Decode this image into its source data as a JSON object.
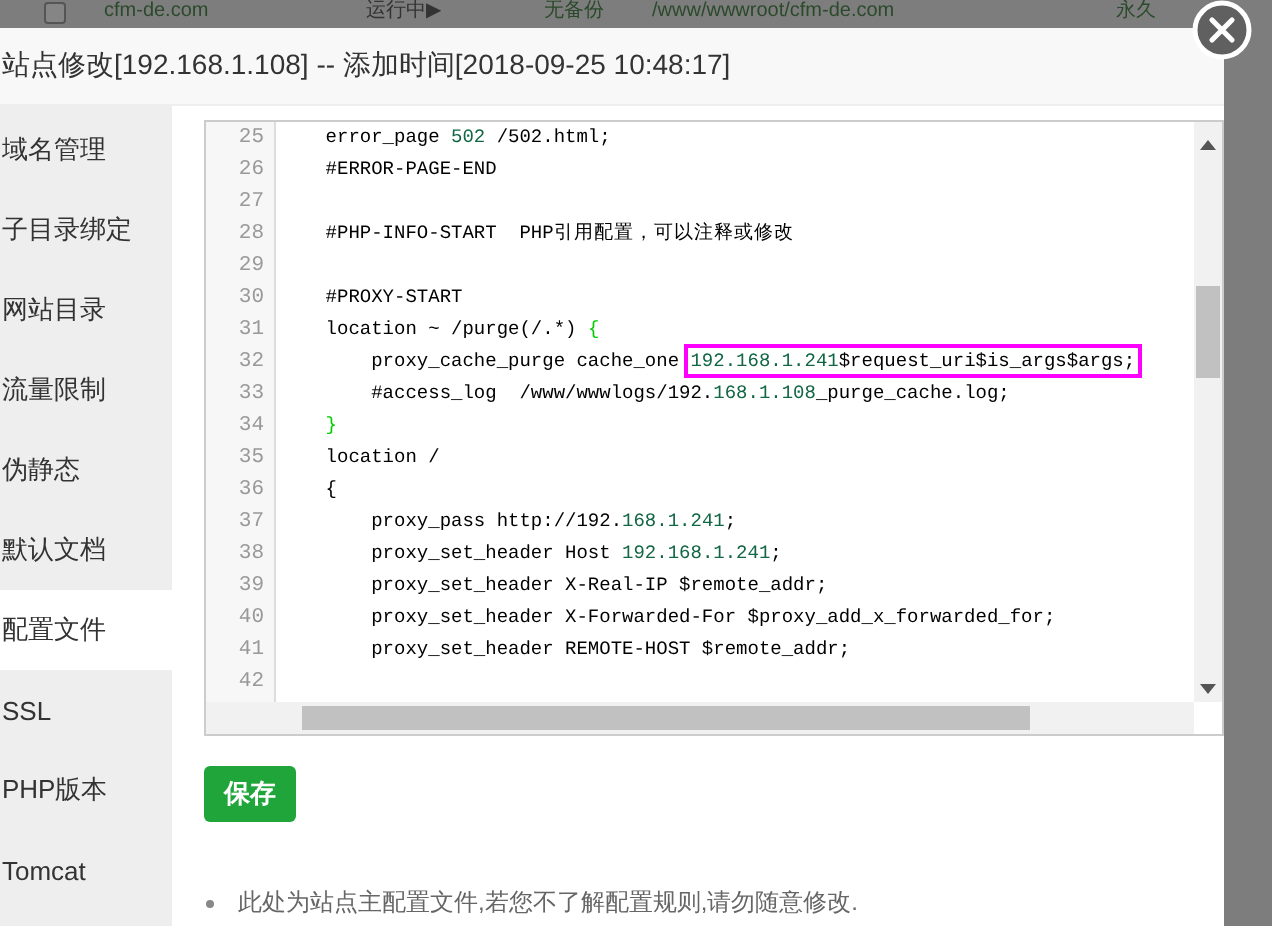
{
  "background_row": {
    "checked": false,
    "cells": [
      "cfm-de.com",
      "运行中▶",
      "无备份",
      "/www/wwwroot/cfm-de.com",
      "永久"
    ]
  },
  "dialog": {
    "title": "站点修改[192.168.1.108] -- 添加时间[2018-09-25 10:48:17]"
  },
  "sidebar": {
    "items": [
      {
        "label": "域名管理",
        "selected": false
      },
      {
        "label": "子目录绑定",
        "selected": false
      },
      {
        "label": "网站目录",
        "selected": false
      },
      {
        "label": "流量限制",
        "selected": false
      },
      {
        "label": "伪静态",
        "selected": false
      },
      {
        "label": "默认文档",
        "selected": false
      },
      {
        "label": "配置文件",
        "selected": true
      },
      {
        "label": "SSL",
        "selected": false
      },
      {
        "label": "PHP版本",
        "selected": false
      },
      {
        "label": "Tomcat",
        "selected": false
      }
    ]
  },
  "editor": {
    "lines": [
      {
        "number": "25",
        "segments": [
          {
            "kind": "text",
            "text": "    error_page "
          },
          {
            "kind": "number",
            "text": "502"
          },
          {
            "kind": "text",
            "text": " /502.html;"
          }
        ]
      },
      {
        "number": "26",
        "segments": [
          {
            "kind": "text",
            "text": "    #ERROR-PAGE-END"
          }
        ]
      },
      {
        "number": "27"
      },
      {
        "number": "28",
        "segments": [
          {
            "kind": "text",
            "text": "    #PHP-INFO-START  PHP引用配置，可以注释或修改"
          }
        ]
      },
      {
        "number": "29"
      },
      {
        "number": "30",
        "segments": [
          {
            "kind": "text",
            "text": "    #PROXY-START"
          }
        ]
      },
      {
        "number": "31",
        "segments": [
          {
            "kind": "text",
            "text": "    location ~ /purge(/.*) "
          },
          {
            "kind": "bracket",
            "text": "{"
          }
        ]
      },
      {
        "number": "32",
        "segments": [
          {
            "kind": "text",
            "text": "        proxy_cache_purge cache_one "
          },
          {
            "kind": "mark",
            "segments": [
              {
                "kind": "number",
                "text": "192.168.1.241"
              },
              {
                "kind": "text",
                "text": "$request_uri$is_args$args;"
              }
            ]
          }
        ]
      },
      {
        "number": "33",
        "segments": [
          {
            "kind": "text",
            "text": "        #access_log  /www/wwwlogs/192."
          },
          {
            "kind": "number",
            "text": "168.1.108"
          },
          {
            "kind": "text",
            "text": "_purge_cache.log;"
          }
        ]
      },
      {
        "number": "34",
        "segments": [
          {
            "kind": "bracket",
            "text": "    }"
          }
        ]
      },
      {
        "number": "35",
        "segments": [
          {
            "kind": "text",
            "text": "    location /"
          }
        ]
      },
      {
        "number": "36",
        "segments": [
          {
            "kind": "text",
            "text": "    {"
          }
        ]
      },
      {
        "number": "37",
        "segments": [
          {
            "kind": "text",
            "text": "        proxy_pass http://192."
          },
          {
            "kind": "number",
            "text": "168.1.241"
          },
          {
            "kind": "text",
            "text": ";"
          }
        ]
      },
      {
        "number": "38",
        "segments": [
          {
            "kind": "text",
            "text": "        proxy_set_header Host "
          },
          {
            "kind": "number",
            "text": "192.168.1.241"
          },
          {
            "kind": "text",
            "text": ";"
          }
        ]
      },
      {
        "number": "39",
        "segments": [
          {
            "kind": "text",
            "text": "        proxy_set_header X-Real-IP $remote_addr;"
          }
        ]
      },
      {
        "number": "40",
        "segments": [
          {
            "kind": "text",
            "text": "        proxy_set_header X-Forwarded-For $proxy_add_x_forwarded_for;"
          }
        ]
      },
      {
        "number": "41",
        "segments": [
          {
            "kind": "text",
            "text": "        proxy_set_header REMOTE-HOST $remote_addr;"
          }
        ]
      },
      {
        "number": "42"
      }
    ]
  },
  "save_button": "保存",
  "notes": [
    "此处为站点主配置文件,若您不了解配置规则,请勿随意修改."
  ]
}
